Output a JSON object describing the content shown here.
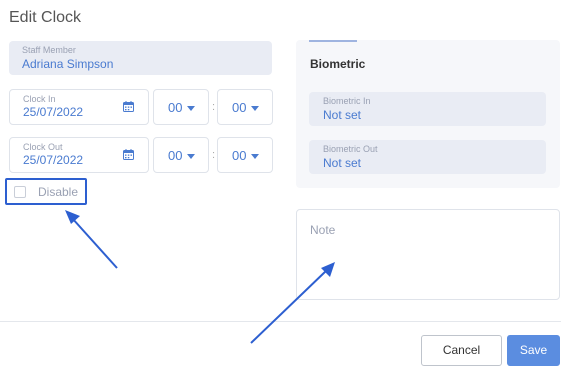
{
  "dialog": {
    "title": "Edit Clock"
  },
  "staff": {
    "label": "Staff Member",
    "value": "Adriana Simpson"
  },
  "clock_in": {
    "label": "Clock In",
    "date": "25/07/2022",
    "hour": "00",
    "minute": "00"
  },
  "clock_out": {
    "label": "Clock Out",
    "date": "25/07/2022",
    "hour": "00",
    "minute": "00"
  },
  "time_separator": ":",
  "disable": {
    "label": "Disable",
    "checked": false
  },
  "biometric": {
    "title": "Biometric",
    "in": {
      "label": "Biometric In",
      "value": "Not set"
    },
    "out": {
      "label": "Biometric Out",
      "value": "Not set"
    }
  },
  "note": {
    "placeholder": "Note"
  },
  "footer": {
    "cancel_label": "Cancel",
    "save_label": "Save"
  },
  "colors": {
    "accent": "#4a7bd0",
    "save_button": "#5b8de0",
    "annotation": "#2d5fd0"
  },
  "icons": {
    "date": "calendar-icon",
    "dropdown": "caret-down-icon"
  }
}
